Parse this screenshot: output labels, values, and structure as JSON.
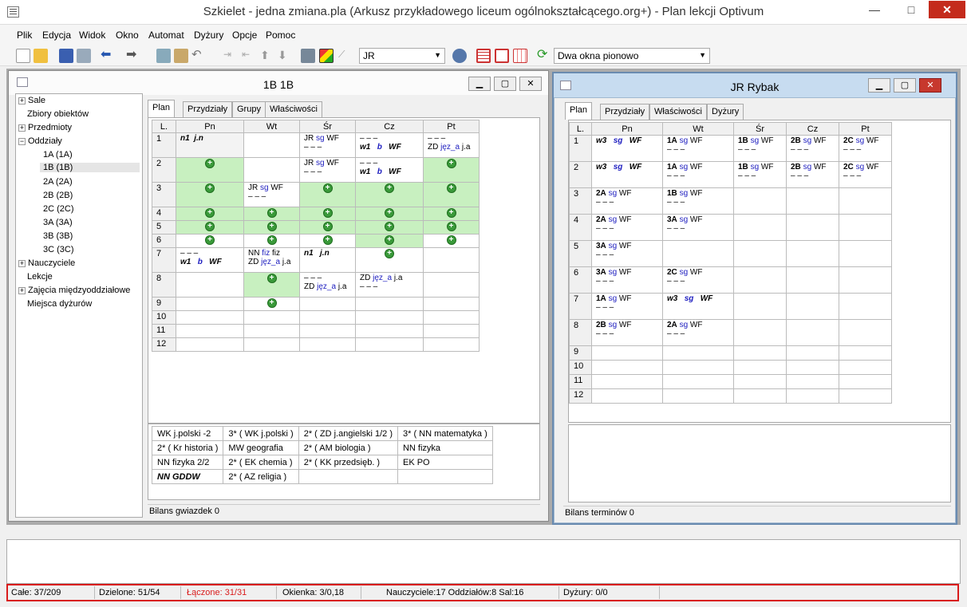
{
  "title": "Szkielet - jedna zmiana.pla (Arkusz przykładowego liceum ogólnokształcącego.org+) - Plan lekcji Optivum",
  "window_buttons": {
    "min": "—",
    "max": "□",
    "close": "✕"
  },
  "menu": [
    "Plik",
    "Edycja",
    "Widok",
    "Okno",
    "Automat",
    "Dyżury",
    "Opcje",
    "Pomoc"
  ],
  "toolbar": {
    "teacher_combo": "JR",
    "layout_combo": "Dwa okna pionowo"
  },
  "left_window": {
    "title": "1B 1B",
    "tabs": [
      "Plan",
      "Przydziały",
      "Grupy",
      "Właściwości"
    ],
    "status": "Bilans gwiazdek 0"
  },
  "tree": [
    "Sale",
    "Zbiory obiektów",
    "Przedmioty",
    "Oddziały",
    "1A (1A)",
    "1B (1B)",
    "2A (2A)",
    "2B (2B)",
    "2C (2C)",
    "3A (3A)",
    "3B (3B)",
    "3C (3C)",
    "Nauczyciele",
    "Lekcje",
    "Zajęcia międzyoddziałowe",
    "Miejsca dyżurów"
  ],
  "days": [
    "Pn",
    "Wt",
    "Śr",
    "Cz",
    "Pt"
  ],
  "lnum_label": "L.",
  "dash": "– – –",
  "left_grid": {
    "1": [
      [
        "n1 j.n"
      ],
      [
        "",
        ""
      ],
      [
        "JR sg WF",
        "– – –"
      ],
      [
        "– – –",
        "w1 b WF"
      ],
      [
        "– – –",
        "ZD język_a j.a"
      ]
    ],
    "2": [
      [
        "*"
      ],
      [
        ""
      ],
      [
        "JR sg WF",
        "– – –"
      ],
      [
        "– – –",
        "w1 b WF"
      ],
      [
        "*"
      ]
    ],
    "3": [
      [
        "*"
      ],
      [
        "JR sg WF",
        "– – –"
      ],
      [
        "*"
      ],
      [
        "*"
      ],
      [
        "*"
      ]
    ]
  },
  "left_cells": {
    "r1c1": "n1",
    "r1c1b": "j.n",
    "jr": "JR",
    "sg": "sg",
    "wf": "WF",
    "w1": "w1",
    "b": "b",
    "zd": "ZD",
    "jeza": "jęz_a",
    "ja": "j.a",
    "nn": "NN",
    "fiz": "fiz",
    "fiz2": "fiz",
    "n1": "n1",
    "jn": "j.n"
  },
  "lessons": [
    "1",
    "2",
    "3",
    "4",
    "5",
    "6",
    "7",
    "8",
    "9",
    "10",
    "11",
    "12"
  ],
  "legend": [
    [
      "WK  j.polski  -2",
      "3* ( WK  j.polski )",
      "2* ( ZD  j.angielski 1/2 )",
      "3* ( NN  matematyka )"
    ],
    [
      "2* ( Kr  historia )",
      "MW  geografia",
      "2* ( AM  biologia )",
      "NN  fizyka"
    ],
    [
      "NN  fizyka  2/2",
      "2* ( EK  chemia )",
      "2* ( KK  przedsięb. )",
      "EK  PO"
    ],
    [
      "NN    GDDW",
      "2* ( AZ  religia )",
      "",
      ""
    ]
  ],
  "right_window": {
    "title": "JR Rybak",
    "tabs": [
      "Plan",
      "Przydziały",
      "Właściwości",
      "Dyżury"
    ],
    "status": "Bilans terminów 0"
  },
  "right_classes": {
    "r1": [
      "w3",
      "1A",
      "1B",
      "2B",
      "2C"
    ],
    "r2": [
      "w3",
      "1A",
      "1B",
      "2B",
      "2C"
    ],
    "r3": [
      "2A",
      "1B"
    ],
    "r4": [
      "2A",
      "3A"
    ],
    "r5": [
      "3A"
    ],
    "r6": [
      "3A",
      "2C"
    ],
    "r7": [
      "1A",
      "w3"
    ],
    "r8": [
      "2B",
      "2A"
    ]
  },
  "status": [
    "Całe: 37/209",
    "Dzielone: 51/54",
    "Łączone: 31/31",
    "Okienka: 3/0,18",
    "Nauczyciele:17  Oddziałów:8  Sal:16",
    "Dyżury: 0/0"
  ]
}
